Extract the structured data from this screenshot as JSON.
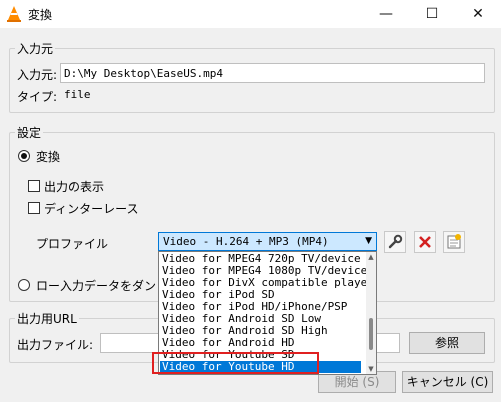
{
  "window": {
    "title": "変換",
    "minimize_symbol": "—",
    "maximize_symbol": "☐",
    "close_symbol": "✕"
  },
  "source": {
    "group_label": "入力元",
    "input_label": "入力元:",
    "input_value": "D:\\My Desktop\\EaseUS.mp4",
    "type_label": "タイプ:",
    "type_value": "file"
  },
  "settings": {
    "group_label": "設定",
    "convert_label": "変換",
    "show_output_label": "出力の表示",
    "deinterlace_label": "ディンターレース",
    "profile_label": "プロファイル",
    "profile_selected": "Video - H.264 + MP3 (MP4)",
    "raw_input_label": "ロー入力データをダン"
  },
  "profile_options": [
    "Video for MPEG4 720p TV/device",
    "Video for MPEG4 1080p TV/device",
    "Video for DivX compatible player",
    "Video for iPod SD",
    "Video for iPod HD/iPhone/PSP",
    "Video for Android SD Low",
    "Video for Android SD High",
    "Video for Android HD",
    "Video for Youtube SD",
    "Video for Youtube HD"
  ],
  "selected_option_index": 9,
  "output": {
    "group_label": "出力用URL",
    "file_label": "出力ファイル:",
    "browse_button": "参照"
  },
  "footer": {
    "start_button": "開始 (S)",
    "cancel_button": "キャンセル (C)"
  },
  "icons": [
    "vlc-cone-icon",
    "wrench-icon",
    "delete-icon",
    "new-profile-icon"
  ],
  "colors": {
    "selection": "#0078d7",
    "highlight_box": "#e02020",
    "delete": "#d32020"
  }
}
